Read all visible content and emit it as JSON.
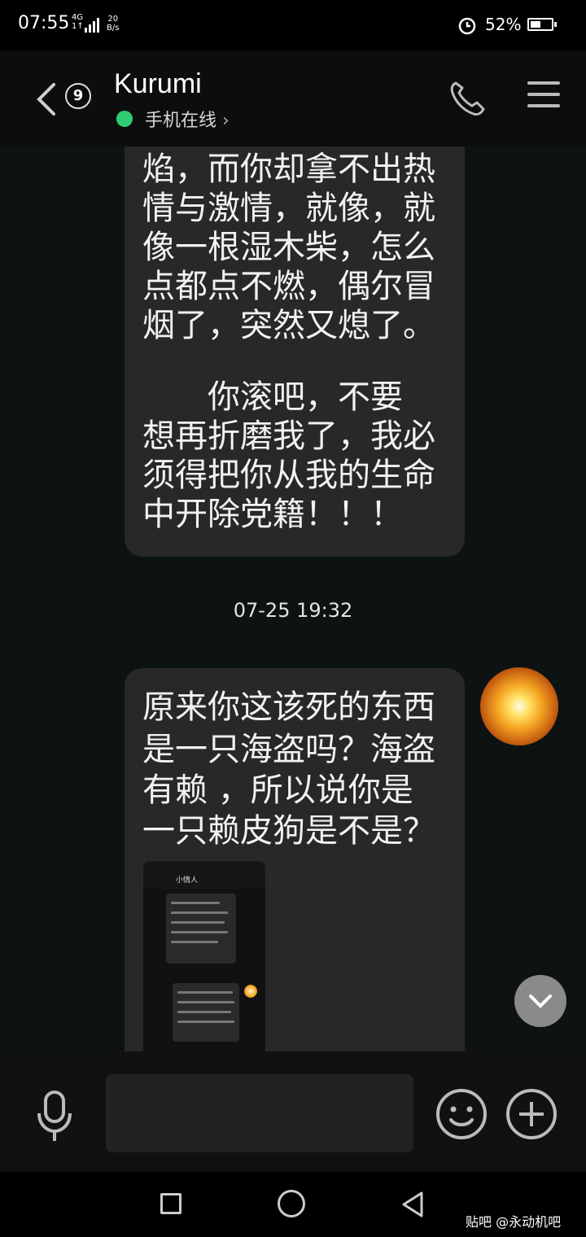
{
  "status_bar": {
    "time": "07:55",
    "network": "4G",
    "sub_network": "1↑",
    "hd": "HD",
    "speed_value": "20",
    "speed_unit": "B/s",
    "battery": "52%",
    "battery_level": 0.52
  },
  "header": {
    "unread_count": "9",
    "contact_name": "Kurumi",
    "online_status": "手机在线",
    "status_color": "#2ecc71"
  },
  "messages": [
    {
      "lines": [
        "焰，而你却拿不出热",
        "情与激情，就像，就",
        "像一根湿木柴，怎么",
        "点都点不燃，偶尔冒",
        "烟了，突然又熄了。",
        "",
        "　　你滚吧，不要",
        "想再折磨我了，我必",
        "须得把你从我的生命",
        "中开除党籍！！！"
      ]
    },
    {
      "lines": [
        "原来你这该死的东西",
        "是一只海盗吗？海盗",
        "有赖 ，所以说你是",
        "一只赖皮狗是不是？"
      ],
      "image_thumbnail": {
        "contact": "小情人"
      }
    }
  ],
  "timestamp": "07-25 19:32",
  "watermark": "贴吧 @永动机吧"
}
